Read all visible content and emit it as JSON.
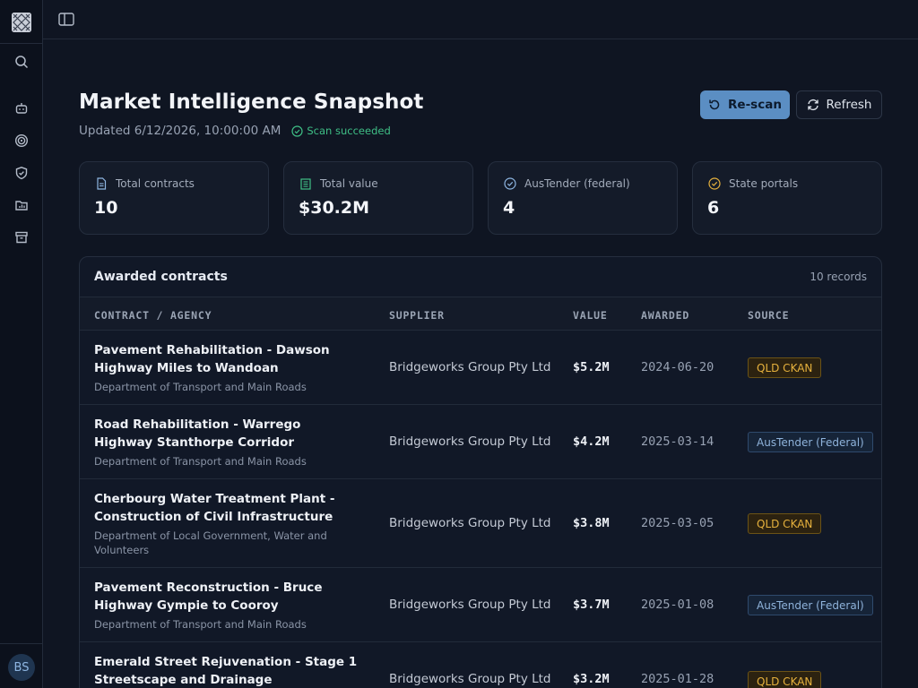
{
  "app": {
    "avatar_initials": "BS"
  },
  "sidebar": {
    "items": [
      {
        "icon": "search-icon"
      },
      {
        "icon": "bot-icon"
      },
      {
        "icon": "target-icon"
      },
      {
        "icon": "shield-icon"
      },
      {
        "icon": "folder-chart-icon"
      },
      {
        "icon": "archive-icon"
      }
    ]
  },
  "header": {
    "title": "Market Intelligence Snapshot",
    "updated": "Updated 6/12/2026, 10:00:00 AM",
    "scan_status": "Scan succeeded",
    "rescan_label": "Re-scan",
    "refresh_label": "Refresh"
  },
  "stats": [
    {
      "label": "Total contracts",
      "value": "10",
      "icon": "file-icon",
      "color": "#8eb6e2"
    },
    {
      "label": "Total value",
      "value": "$30.2M",
      "icon": "building-icon",
      "color": "#3fbf86"
    },
    {
      "label": "AusTender (federal)",
      "value": "4",
      "icon": "check-circle-icon",
      "color": "#8eb6e2"
    },
    {
      "label": "State portals",
      "value": "6",
      "icon": "check-circle-icon",
      "color": "#e6b13d"
    }
  ],
  "table": {
    "title": "Awarded contracts",
    "record_count": "10 records",
    "columns": [
      "CONTRACT / AGENCY",
      "SUPPLIER",
      "VALUE",
      "AWARDED",
      "SOURCE"
    ],
    "rows": [
      {
        "title": "Pavement Rehabilitation - Dawson Highway Miles to Wandoan",
        "agency": "Department of Transport and Main Roads",
        "supplier": "Bridgeworks Group Pty Ltd",
        "value": "$5.2M",
        "awarded": "2024-06-20",
        "source": "QLD CKAN"
      },
      {
        "title": "Road Rehabilitation - Warrego Highway Stanthorpe Corridor",
        "agency": "Department of Transport and Main Roads",
        "supplier": "Bridgeworks Group Pty Ltd",
        "value": "$4.2M",
        "awarded": "2025-03-14",
        "source": "AusTender (Federal)"
      },
      {
        "title": "Cherbourg Water Treatment Plant - Construction of Civil Infrastructure",
        "agency": "Department of Local Government, Water and Volunteers",
        "supplier": "Bridgeworks Group Pty Ltd",
        "value": "$3.8M",
        "awarded": "2025-03-05",
        "source": "QLD CKAN"
      },
      {
        "title": "Pavement Reconstruction - Bruce Highway Gympie to Cooroy",
        "agency": "Department of Transport and Main Roads",
        "supplier": "Bridgeworks Group Pty Ltd",
        "value": "$3.7M",
        "awarded": "2025-01-08",
        "source": "AusTender (Federal)"
      },
      {
        "title": "Emerald Street Rejuvenation - Stage 1 Streetscape and Drainage",
        "agency": "",
        "supplier": "Bridgeworks Group Pty Ltd",
        "value": "$3.2M",
        "awarded": "2025-01-28",
        "source": "QLD CKAN"
      }
    ]
  }
}
